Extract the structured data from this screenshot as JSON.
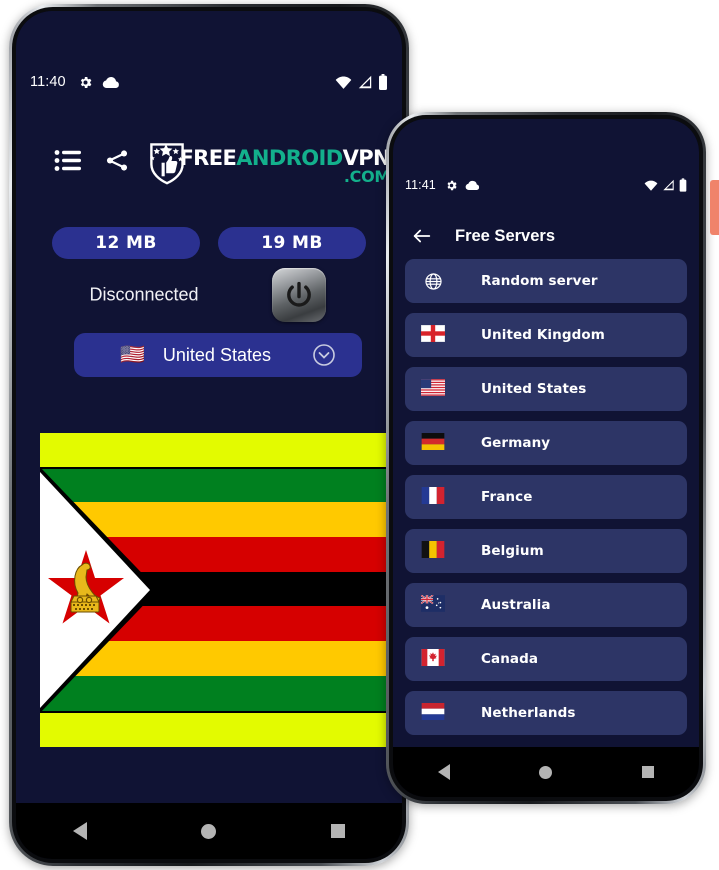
{
  "phone1": {
    "statusbar": {
      "time": "11:40",
      "icons": [
        "gear-icon",
        "cloud-icon",
        "wifi-icon",
        "signal-icon",
        "battery-icon"
      ]
    },
    "toolbar": {
      "icons": [
        {
          "name": "list-icon",
          "label": "Menu"
        },
        {
          "name": "share-icon",
          "label": "Share"
        },
        {
          "name": "rate-icon",
          "label": "Rate us"
        }
      ]
    },
    "logo": {
      "free": "FREE",
      "android": "ANDROID",
      "vpn": "VPN",
      "com": ".COM",
      "white_color": "#ffffff",
      "teal_color": "#13b08c"
    },
    "chips": [
      {
        "name": "download-usage",
        "value": "12 MB"
      },
      {
        "name": "upload-usage",
        "value": "19 MB"
      }
    ],
    "connection": {
      "status": "Disconnected",
      "power_button": "power-icon"
    },
    "country_selector": {
      "flag": "🇺🇸",
      "name": "United States",
      "chevron": "chevron-down-icon"
    },
    "navbar": {
      "back": "back-icon",
      "home": "home-icon",
      "recents": "recents-icon"
    },
    "flag_banner": {
      "country": "Zimbabwe",
      "band_color": "#e3fb00",
      "stripes": [
        "#00801f",
        "#ffc900",
        "#d60000",
        "#000000",
        "#d60000",
        "#ffc900",
        "#00801f"
      ],
      "hoist_triangle": "#ffffff",
      "star_color": "#d60000",
      "bird_color": "#e8b81b"
    }
  },
  "phone2": {
    "statusbar": {
      "time": "11:41",
      "icons": [
        "gear-icon",
        "cloud-icon",
        "wifi-icon",
        "signal-icon",
        "battery-icon"
      ]
    },
    "appbar": {
      "back": "back-arrow-icon",
      "title": "Free Servers"
    },
    "servers": [
      {
        "flag": "globe",
        "name": "Random server"
      },
      {
        "flag": "🏴󠁧󠁢󠁥󠁮󠁧󠁿",
        "name": "United Kingdom"
      },
      {
        "flag": "🇺🇸",
        "name": "United States"
      },
      {
        "flag": "🇩🇪",
        "name": "Germany"
      },
      {
        "flag": "🇫🇷",
        "name": "France"
      },
      {
        "flag": "🇧🇪",
        "name": "Belgium"
      },
      {
        "flag": "🇦🇺",
        "name": "Australia"
      },
      {
        "flag": "🇨🇦",
        "name": "Canada"
      },
      {
        "flag": "🇳🇱",
        "name": "Netherlands"
      },
      {
        "flag": "",
        "name": ""
      }
    ],
    "navbar": {
      "back": "back-icon",
      "home": "home-icon",
      "recents": "recents-icon"
    }
  },
  "theme": {
    "screen_bg": "#101334",
    "chip_bg": "#2b3190",
    "list_item_bg": "#2d3566",
    "accent_orange": "#f0836a"
  }
}
